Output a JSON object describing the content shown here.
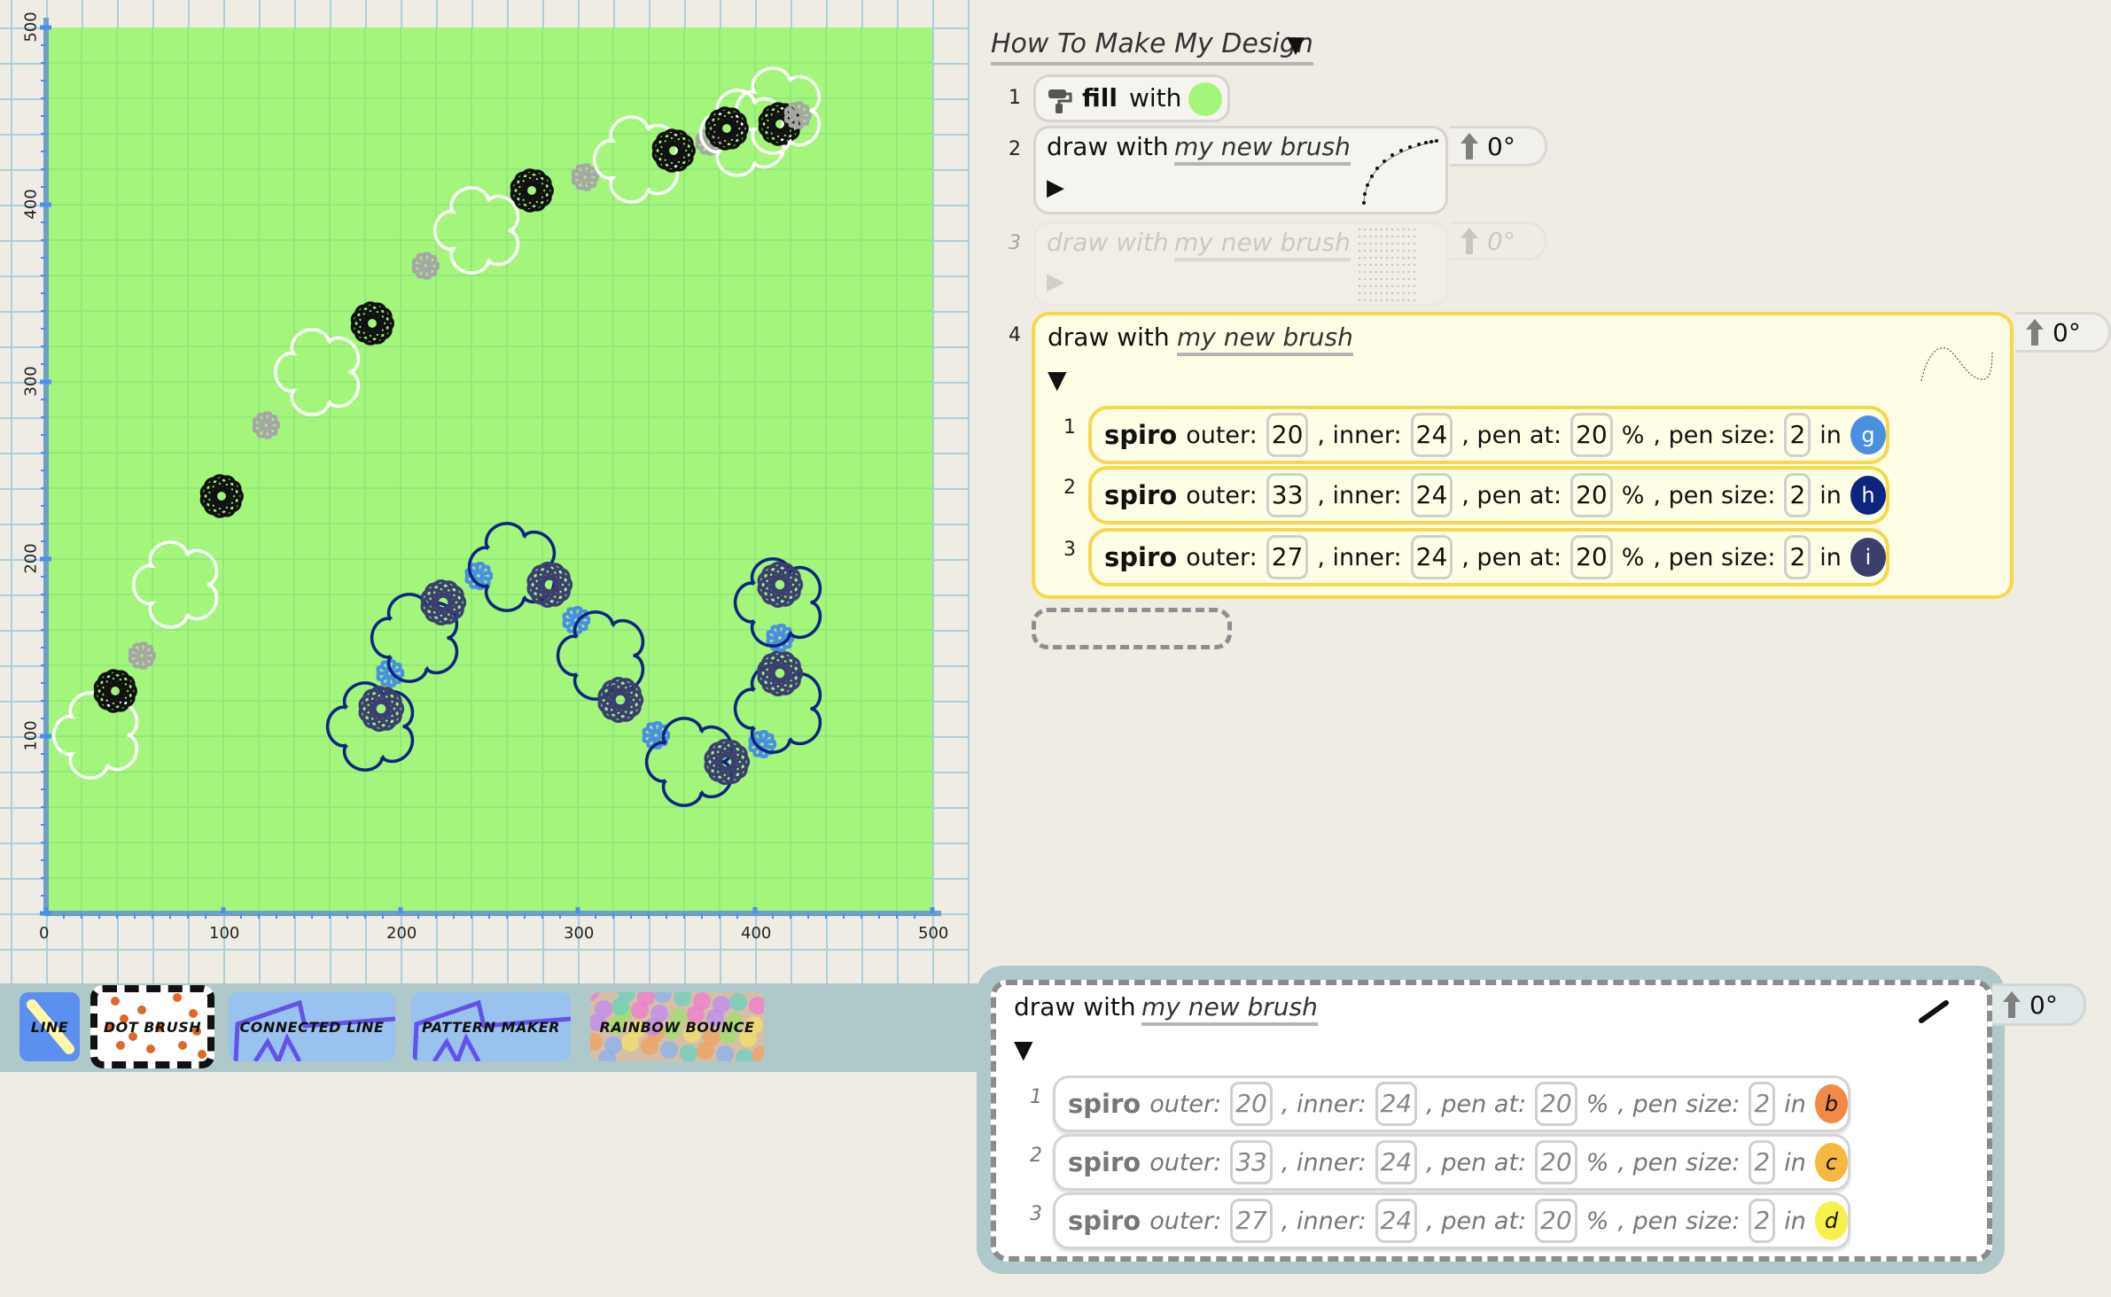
{
  "canvas": {
    "background_color": "#a3f57c",
    "x_axis": {
      "min": 0,
      "max": 500,
      "ticks": [
        "0",
        "100",
        "200",
        "300",
        "400",
        "500"
      ]
    },
    "y_axis": {
      "min": 0,
      "max": 500,
      "ticks": [
        "100",
        "200",
        "300",
        "400",
        "500"
      ]
    }
  },
  "toolbar": {
    "brushes": [
      {
        "label": "LINE",
        "selected": false
      },
      {
        "label": "DOT BRUSH",
        "selected": true
      },
      {
        "label": "CONNECTED LINE",
        "selected": false
      },
      {
        "label": "PATTERN MAKER",
        "selected": false
      },
      {
        "label": "RAINBOW BOUNCE",
        "selected": false
      }
    ]
  },
  "script": {
    "title": "How To Make My Design",
    "title_caret": "▼",
    "steps": [
      {
        "number": "1",
        "verb": "fill",
        "with": "with",
        "color": "#a3f57c",
        "icon": "paint-roller-icon"
      },
      {
        "number": "2",
        "prefix": "draw with",
        "brush": "my new brush",
        "toggle": "▶",
        "angle": "0°",
        "enabled": true
      },
      {
        "number": "3",
        "prefix": "draw with",
        "brush": "my new brush",
        "toggle": "▶",
        "angle": "0°",
        "enabled": false
      },
      {
        "number": "4",
        "prefix": "draw with",
        "brush": "my new brush",
        "toggle": "▼",
        "angle": "0°",
        "enabled": true,
        "spiros": [
          {
            "number": "1",
            "name": "spiro",
            "outer_label": "outer:",
            "outer": "20",
            "inner_label": ", inner:",
            "inner": "24",
            "pen_at_label": ", pen at:",
            "pen_at": "20",
            "pct": "%",
            "pen_size_label": ", pen size:",
            "pen_size": "2",
            "in": "in",
            "color_letter": "g",
            "color": "#4a8fe0"
          },
          {
            "number": "2",
            "name": "spiro",
            "outer_label": "outer:",
            "outer": "33",
            "inner_label": ", inner:",
            "inner": "24",
            "pen_at_label": ", pen at:",
            "pen_at": "20",
            "pct": "%",
            "pen_size_label": ", pen size:",
            "pen_size": "2",
            "in": "in",
            "color_letter": "h",
            "color": "#0d2580"
          },
          {
            "number": "3",
            "name": "spiro",
            "outer_label": "outer:",
            "outer": "27",
            "inner_label": ", inner:",
            "inner": "24",
            "pen_at_label": ", pen at:",
            "pen_at": "20",
            "pct": "%",
            "pen_size_label": ", pen size:",
            "pen_size": "2",
            "in": "in",
            "color_letter": "i",
            "color": "#3b3f6e"
          }
        ]
      }
    ]
  },
  "brush_editor": {
    "prefix": "draw with",
    "brush": "my new brush",
    "toggle": "▼",
    "angle": "0°",
    "spiros": [
      {
        "number": "1",
        "name": "spiro",
        "outer_label": "outer:",
        "outer": "20",
        "inner_label": ", inner:",
        "inner": "24",
        "pen_at_label": ", pen at:",
        "pen_at": "20",
        "pct": "%",
        "pen_size_label": ", pen size:",
        "pen_size": "2",
        "in": "in",
        "color_letter": "b",
        "color": "#f08a45"
      },
      {
        "number": "2",
        "name": "spiro",
        "outer_label": "outer:",
        "outer": "33",
        "inner_label": ", inner:",
        "inner": "24",
        "pen_at_label": ", pen at:",
        "pen_at": "20",
        "pct": "%",
        "pen_size_label": ", pen size:",
        "pen_size": "2",
        "in": "in",
        "color_letter": "c",
        "color": "#f5b942"
      },
      {
        "number": "3",
        "name": "spiro",
        "outer_label": "outer:",
        "outer": "27",
        "inner_label": ", inner:",
        "inner": "24",
        "pen_at_label": ", pen at:",
        "pen_at": "20",
        "pct": "%",
        "pen_size_label": ", pen size:",
        "pen_size": "2",
        "in": "in",
        "color_letter": "d",
        "color": "#f7f04a"
      }
    ]
  }
}
